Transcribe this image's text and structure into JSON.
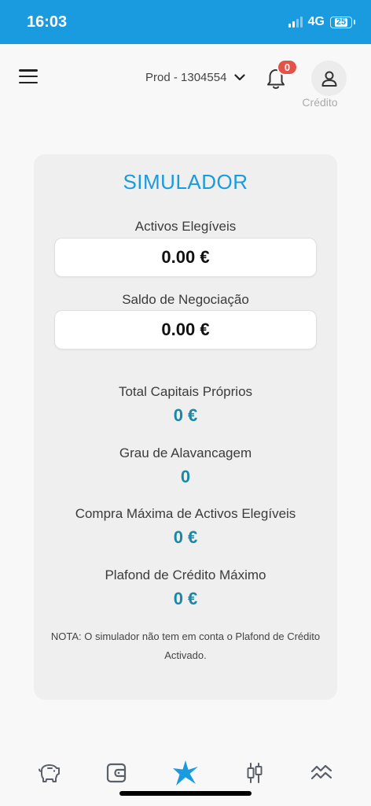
{
  "status_bar": {
    "time": "16:03",
    "network": "4G",
    "battery": "25"
  },
  "header": {
    "account_label": "Prod - 1304554",
    "notification_count": "0",
    "profile_label": "Crédito"
  },
  "simulator": {
    "title": "SIMULADOR",
    "eligible_assets": {
      "label": "Activos Elegíveis",
      "value": "0.00 €"
    },
    "trading_balance": {
      "label": "Saldo de Negociação",
      "value": "0.00 €"
    },
    "stats": [
      {
        "label": "Total Capitais Próprios",
        "value": "0 €"
      },
      {
        "label": "Grau de Alavancagem",
        "value": "0"
      },
      {
        "label": "Compra Máxima de Activos Elegíveis",
        "value": "0 €"
      },
      {
        "label": "Plafond de Crédito Máximo",
        "value": "0 €"
      }
    ],
    "note": "NOTA: O simulador não tem em conta o Plafond de Crédito Activado."
  },
  "bottom_nav": {
    "items": [
      {
        "icon": "piggy-bank-icon"
      },
      {
        "icon": "wallet-icon"
      },
      {
        "icon": "star-logo-icon",
        "active": true
      },
      {
        "icon": "candlestick-icon"
      },
      {
        "icon": "market-waves-icon"
      }
    ]
  },
  "colors": {
    "accent": "#1a9be0",
    "value": "#1a87a6",
    "badge": "#e2534a",
    "icon": "#5a6068"
  }
}
